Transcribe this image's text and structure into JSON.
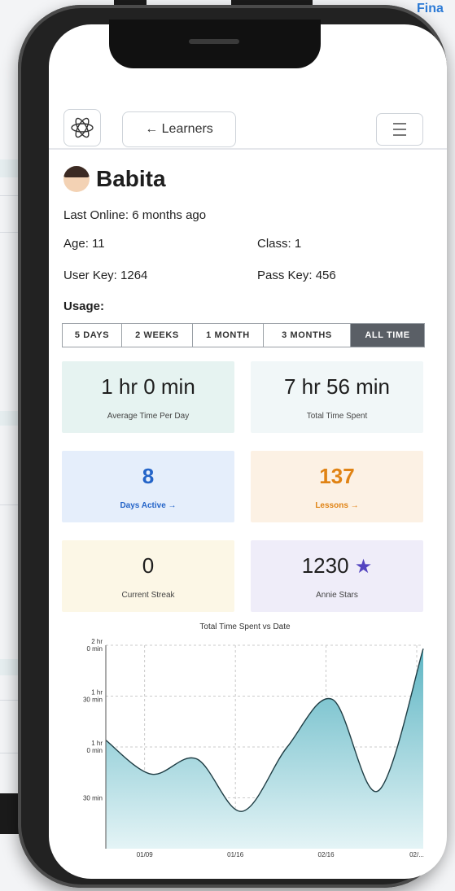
{
  "background": {
    "corner_text": "Fina"
  },
  "header": {
    "back_label": "← Learners",
    "logo_icon": "atom-icon",
    "menu_icon": "hamburger-icon"
  },
  "profile": {
    "name": "Babita",
    "last_online": "Last Online: 6 months ago",
    "age": "Age: 11",
    "class": "Class: 1",
    "user_key": "User Key: 1264",
    "pass_key": "Pass Key: 456",
    "usage_label": "Usage:"
  },
  "usage_tabs": [
    {
      "label": "5 DAYS",
      "active": false
    },
    {
      "label": "2 WEEKS",
      "active": false
    },
    {
      "label": "1 MONTH",
      "active": false
    },
    {
      "label": "3 MONTHS",
      "active": false
    },
    {
      "label": "ALL TIME",
      "active": true
    }
  ],
  "stats": {
    "avg_time": {
      "value": "1 hr 0 min",
      "label": "Average Time Per Day"
    },
    "total_time": {
      "value": "7 hr 56 min",
      "label": "Total Time Spent"
    },
    "days_active": {
      "value": "8",
      "label": "Days Active →"
    },
    "lessons": {
      "value": "137",
      "label": "Lessons →"
    },
    "streak": {
      "value": "0",
      "label": "Current Streak"
    },
    "stars": {
      "value": "1230",
      "label": "Annie Stars",
      "icon": "star-icon"
    }
  },
  "colors": {
    "accent_blue": "#2464c8",
    "accent_orange": "#e08314",
    "star_purple": "#5344c0",
    "chart_fill": "#5fb6c4",
    "active_tab": "#5a5f66"
  },
  "chart_data": {
    "type": "area",
    "title": "Total Time Spent vs Date",
    "y_ticks": [
      "2 hr 0 min",
      "1 hr 30 min",
      "1 hr 0 min",
      "30 min"
    ],
    "x_ticks": [
      "01/09",
      "01/16",
      "02/16",
      "02/..."
    ],
    "ylim_minutes": [
      0,
      120
    ],
    "grid": true,
    "x": [
      0,
      1,
      2,
      3,
      4,
      5,
      6,
      7
    ],
    "values_minutes": [
      64,
      44,
      53,
      22,
      60,
      88,
      34,
      118
    ]
  }
}
